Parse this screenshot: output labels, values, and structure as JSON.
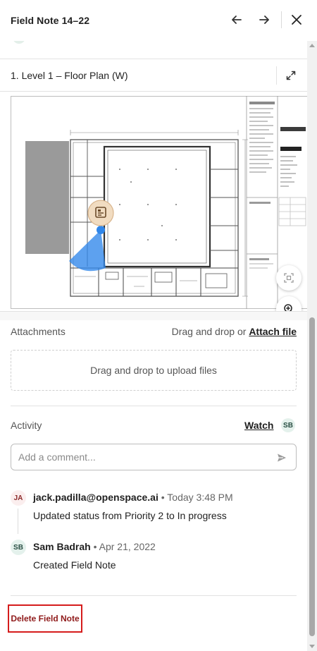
{
  "header": {
    "title": "Field Note 14–22",
    "prev_icon": "arrow-left-icon",
    "next_icon": "arrow-right-icon",
    "close_icon": "close-icon"
  },
  "plan": {
    "title": "1. Level 1 – Floor Plan (W)",
    "expand_icon": "expand-icon"
  },
  "map_controls": {
    "fit_icon": "fit-view-icon",
    "zoom_in_icon": "zoom-in-icon",
    "zoom_out_icon": "zoom-out-icon",
    "marker_icon": "field-note-marker-icon"
  },
  "attachments": {
    "label": "Attachments",
    "drag_text": "Drag and drop or",
    "attach_link": "Attach file",
    "dropzone_text": "Drag and drop to upload files"
  },
  "activity": {
    "label": "Activity",
    "watch_label": "Watch",
    "watcher_initials": "SB",
    "comment_placeholder": "Add a comment...",
    "send_icon": "send-icon",
    "items": [
      {
        "initials": "JA",
        "author": "jack.padilla@openspace.ai",
        "separator": " • ",
        "time": "Today 3:48 PM",
        "text_prefix": "Updated status from ",
        "from_status": "Priority 2",
        "text_mid": " to ",
        "to_status": "In progress"
      },
      {
        "initials": "SB",
        "author": "Sam Badrah",
        "separator": " • ",
        "time": "Apr 21, 2022",
        "text": "Created Field Note"
      }
    ]
  },
  "footer": {
    "delete_label": "Delete Field Note"
  },
  "colors": {
    "accent_delete": "#d51c1c",
    "marker_blue": "#2f86ea",
    "marker_tan": "#f1dcc1"
  }
}
